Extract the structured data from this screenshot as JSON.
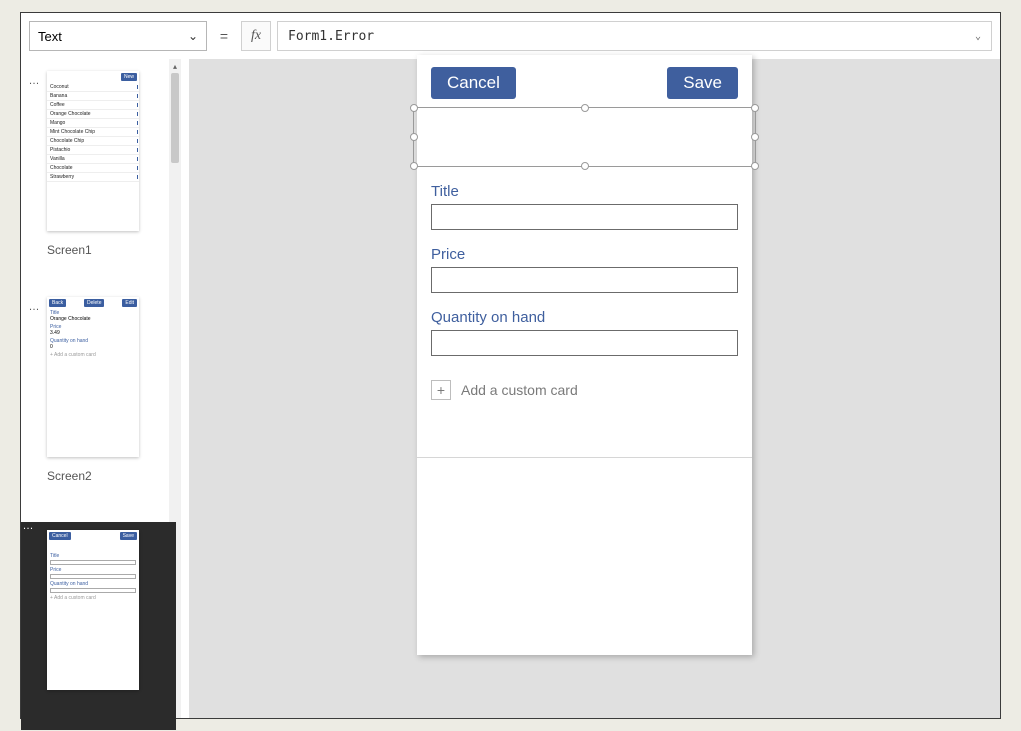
{
  "formulaBar": {
    "property": "Text",
    "equals": "=",
    "fx": "fx",
    "formula": "Form1.Error"
  },
  "thumbs": {
    "screen1": {
      "label": "Screen1",
      "newBtn": "New",
      "items": [
        "Coconut",
        "Banana",
        "Coffee",
        "Orange Chocolate",
        "Mango",
        "Mint Chocolate Chip",
        "Chocolate Chip",
        "Pistachio",
        "Vanilla",
        "Chocolate",
        "Strawberry"
      ]
    },
    "screen2": {
      "label": "Screen2",
      "backBtn": "Back",
      "deleteBtn": "Delete",
      "editBtn": "Edit",
      "fields": [
        {
          "label": "Title",
          "value": "Orange Chocolate"
        },
        {
          "label": "Price",
          "value": "3.49"
        },
        {
          "label": "Quantity on hand",
          "value": "0"
        }
      ],
      "addCard": "+  Add a custom card"
    },
    "screen3": {
      "cancelBtn": "Cancel",
      "saveBtn": "Save",
      "fields": [
        "Title",
        "Price",
        "Quantity on hand"
      ],
      "addCard": "+  Add a custom card"
    }
  },
  "canvasForm": {
    "cancel": "Cancel",
    "save": "Save",
    "fields": [
      {
        "label": "Title"
      },
      {
        "label": "Price"
      },
      {
        "label": "Quantity on hand"
      }
    ],
    "addCard": "Add a custom card"
  }
}
